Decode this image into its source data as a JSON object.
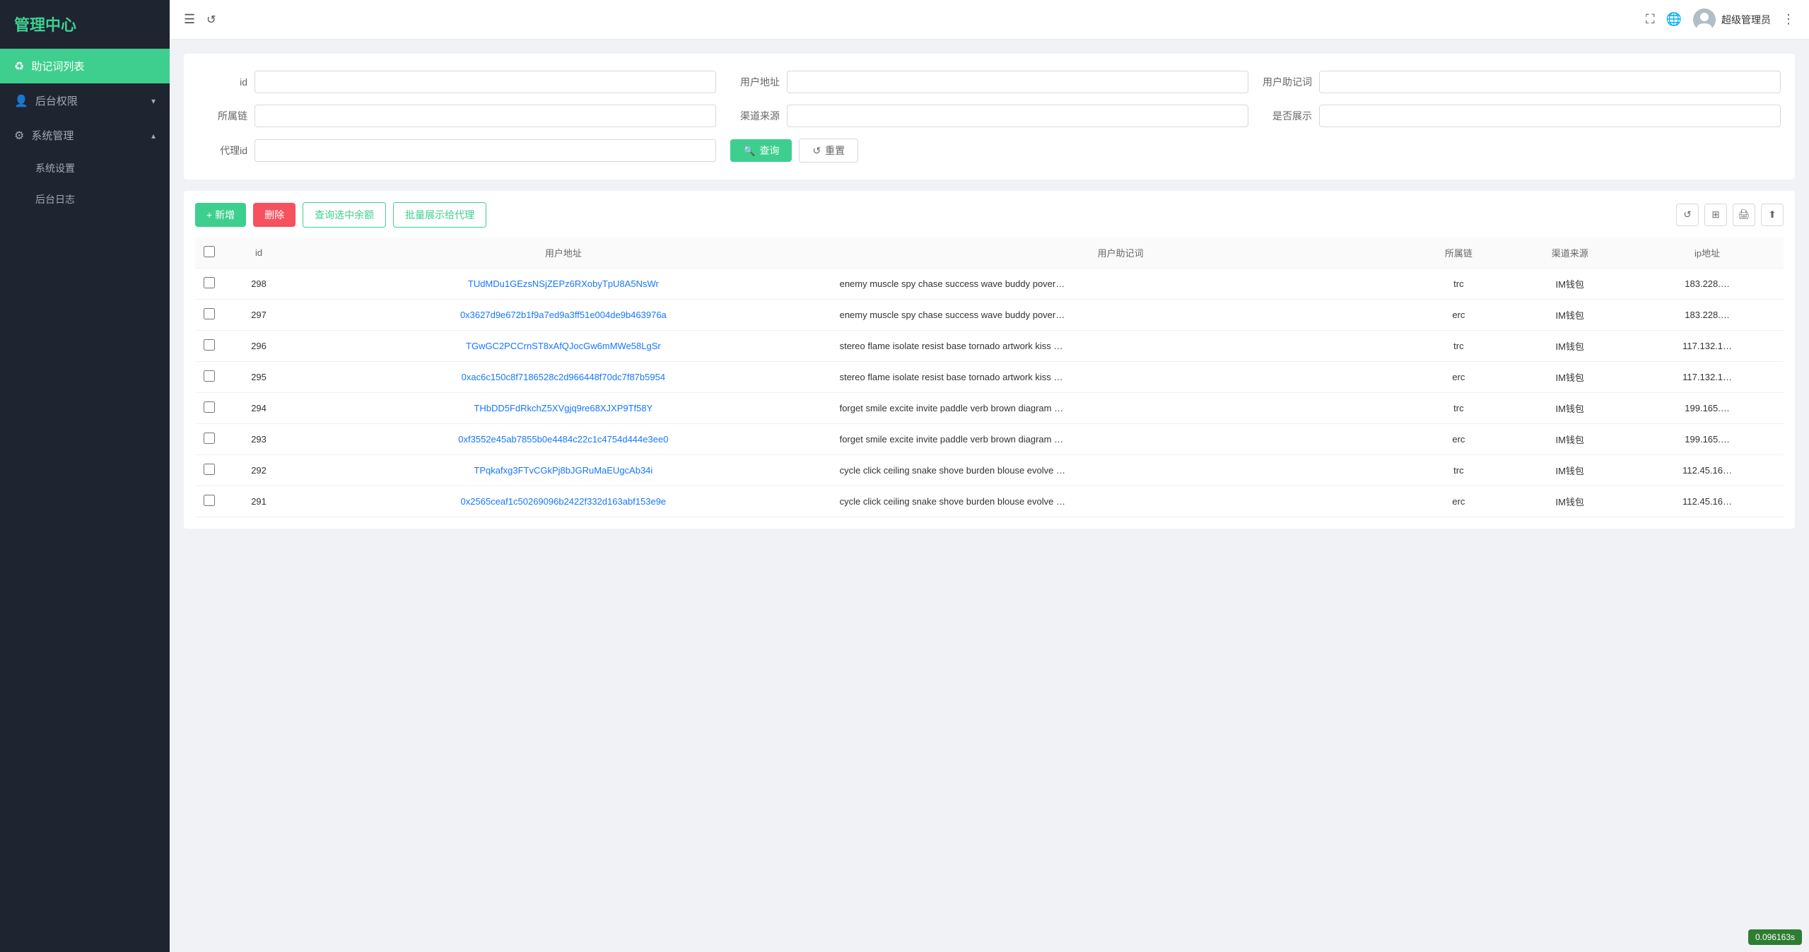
{
  "sidebar": {
    "logo": "管理中心",
    "items": [
      {
        "id": "mnemonics",
        "icon": "♻",
        "label": "助记词列表",
        "active": true
      },
      {
        "id": "permissions",
        "icon": "👤",
        "label": "后台权限",
        "active": false,
        "hasArrow": true
      },
      {
        "id": "system",
        "icon": "⚙",
        "label": "系统管理",
        "active": false,
        "hasArrow": true,
        "expanded": true
      }
    ],
    "subItems": [
      {
        "id": "settings",
        "label": "系统设置"
      },
      {
        "id": "logs",
        "label": "后台日志"
      }
    ]
  },
  "header": {
    "menuIcon": "☰",
    "refreshIcon": "↺",
    "fullscreenIcon": "⛶",
    "globeIcon": "🌐",
    "moreIcon": "⋮",
    "username": "超级管理员"
  },
  "filter": {
    "fields": [
      {
        "id": "id",
        "label": "id",
        "placeholder": ""
      },
      {
        "id": "userAddress",
        "label": "用户地址",
        "placeholder": ""
      },
      {
        "id": "userMnemonic",
        "label": "用户助记词",
        "placeholder": ""
      },
      {
        "id": "chain",
        "label": "所属链",
        "placeholder": ""
      },
      {
        "id": "channel",
        "label": "渠道来源",
        "placeholder": ""
      },
      {
        "id": "isShow",
        "label": "是否展示",
        "placeholder": ""
      },
      {
        "id": "agentId",
        "label": "代理id",
        "placeholder": ""
      }
    ],
    "queryBtn": "查询",
    "resetBtn": "重置"
  },
  "toolbar": {
    "addBtn": "+ 新增",
    "deleteBtn": "删除",
    "checkBalanceBtn": "查询选中余额",
    "batchShowBtn": "批量展示给代理"
  },
  "table": {
    "columns": [
      "id",
      "用户地址",
      "用户助记词",
      "所属链",
      "渠道来源",
      "ip地址"
    ],
    "rows": [
      {
        "id": "298",
        "address": "TUdMDu1GEzsNSjZEPz6RXobyTpU8A5NsWr",
        "mnemonic": "enemy muscle spy chase success wave buddy pover…",
        "chain": "trc",
        "channel": "IM钱包",
        "ip": "183.228.…"
      },
      {
        "id": "297",
        "address": "0x3627d9e672b1f9a7ed9a3ff51e004de9b463976a",
        "mnemonic": "enemy muscle spy chase success wave buddy pover…",
        "chain": "erc",
        "channel": "IM钱包",
        "ip": "183.228.…"
      },
      {
        "id": "296",
        "address": "TGwGC2PCCrnST8xAfQJocGw6mMWe58LgSr",
        "mnemonic": "stereo flame isolate resist base tornado artwork kiss …",
        "chain": "trc",
        "channel": "IM钱包",
        "ip": "117.132.1…"
      },
      {
        "id": "295",
        "address": "0xac6c150c8f7186528c2d966448f70dc7f87b5954",
        "mnemonic": "stereo flame isolate resist base tornado artwork kiss …",
        "chain": "erc",
        "channel": "IM钱包",
        "ip": "117.132.1…"
      },
      {
        "id": "294",
        "address": "THbDD5FdRkchZ5XVgjq9re68XJXP9Tf58Y",
        "mnemonic": "forget smile excite invite paddle verb brown diagram …",
        "chain": "trc",
        "channel": "IM钱包",
        "ip": "199.165.…"
      },
      {
        "id": "293",
        "address": "0xf3552e45ab7855b0e4484c22c1c4754d444e3ee0",
        "mnemonic": "forget smile excite invite paddle verb brown diagram …",
        "chain": "erc",
        "channel": "IM钱包",
        "ip": "199.165.…"
      },
      {
        "id": "292",
        "address": "TPqkafxg3FTvCGkPj8bJGRuMaEUgcAb34i",
        "mnemonic": "cycle click ceiling snake shove burden blouse evolve …",
        "chain": "trc",
        "channel": "IM钱包",
        "ip": "112.45.16…"
      },
      {
        "id": "291",
        "address": "0x2565ceaf1c50269096b2422f332d163abf153e9e",
        "mnemonic": "cycle click ceiling snake shove burden blouse evolve …",
        "chain": "erc",
        "channel": "IM钱包",
        "ip": "112.45.16…"
      }
    ]
  },
  "badge": {
    "value": "0.096163s"
  }
}
